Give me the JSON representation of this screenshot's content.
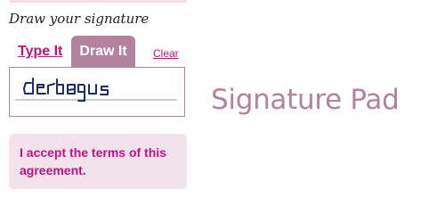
{
  "form": {
    "prompt": "Draw your signature",
    "tabs": [
      {
        "label": "Type It",
        "active": false
      },
      {
        "label": "Draw It",
        "active": true
      }
    ],
    "clear_label": "Clear",
    "accept_text": "I accept the terms of this agreement."
  },
  "brand": {
    "title": "Signature Pad"
  },
  "colors": {
    "accent": "#c0127f",
    "tab_active_bg": "#b3829f",
    "notice_bg": "#f2e2ec",
    "brand_text": "#b3829f",
    "ink": "#1c2a6e"
  }
}
